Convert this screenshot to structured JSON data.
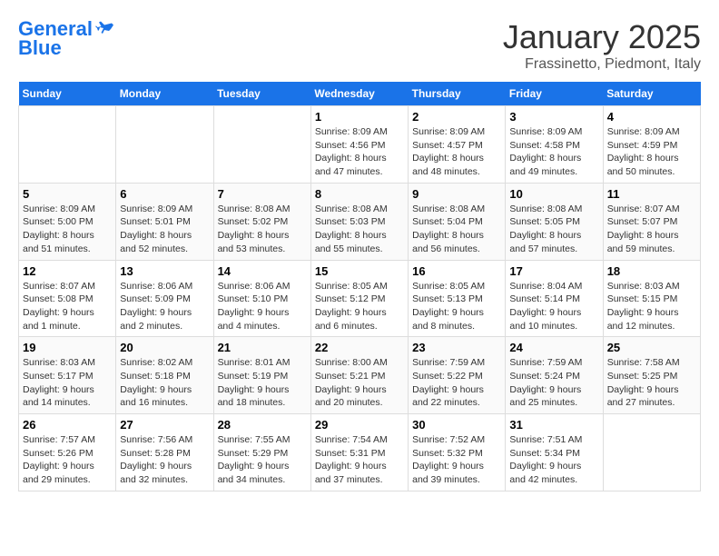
{
  "header": {
    "logo_line1": "General",
    "logo_line2": "Blue",
    "month": "January 2025",
    "location": "Frassinetto, Piedmont, Italy"
  },
  "weekdays": [
    "Sunday",
    "Monday",
    "Tuesday",
    "Wednesday",
    "Thursday",
    "Friday",
    "Saturday"
  ],
  "weeks": [
    [
      {
        "day": "",
        "info": ""
      },
      {
        "day": "",
        "info": ""
      },
      {
        "day": "",
        "info": ""
      },
      {
        "day": "1",
        "info": "Sunrise: 8:09 AM\nSunset: 4:56 PM\nDaylight: 8 hours\nand 47 minutes."
      },
      {
        "day": "2",
        "info": "Sunrise: 8:09 AM\nSunset: 4:57 PM\nDaylight: 8 hours\nand 48 minutes."
      },
      {
        "day": "3",
        "info": "Sunrise: 8:09 AM\nSunset: 4:58 PM\nDaylight: 8 hours\nand 49 minutes."
      },
      {
        "day": "4",
        "info": "Sunrise: 8:09 AM\nSunset: 4:59 PM\nDaylight: 8 hours\nand 50 minutes."
      }
    ],
    [
      {
        "day": "5",
        "info": "Sunrise: 8:09 AM\nSunset: 5:00 PM\nDaylight: 8 hours\nand 51 minutes."
      },
      {
        "day": "6",
        "info": "Sunrise: 8:09 AM\nSunset: 5:01 PM\nDaylight: 8 hours\nand 52 minutes."
      },
      {
        "day": "7",
        "info": "Sunrise: 8:08 AM\nSunset: 5:02 PM\nDaylight: 8 hours\nand 53 minutes."
      },
      {
        "day": "8",
        "info": "Sunrise: 8:08 AM\nSunset: 5:03 PM\nDaylight: 8 hours\nand 55 minutes."
      },
      {
        "day": "9",
        "info": "Sunrise: 8:08 AM\nSunset: 5:04 PM\nDaylight: 8 hours\nand 56 minutes."
      },
      {
        "day": "10",
        "info": "Sunrise: 8:08 AM\nSunset: 5:05 PM\nDaylight: 8 hours\nand 57 minutes."
      },
      {
        "day": "11",
        "info": "Sunrise: 8:07 AM\nSunset: 5:07 PM\nDaylight: 8 hours\nand 59 minutes."
      }
    ],
    [
      {
        "day": "12",
        "info": "Sunrise: 8:07 AM\nSunset: 5:08 PM\nDaylight: 9 hours\nand 1 minute."
      },
      {
        "day": "13",
        "info": "Sunrise: 8:06 AM\nSunset: 5:09 PM\nDaylight: 9 hours\nand 2 minutes."
      },
      {
        "day": "14",
        "info": "Sunrise: 8:06 AM\nSunset: 5:10 PM\nDaylight: 9 hours\nand 4 minutes."
      },
      {
        "day": "15",
        "info": "Sunrise: 8:05 AM\nSunset: 5:12 PM\nDaylight: 9 hours\nand 6 minutes."
      },
      {
        "day": "16",
        "info": "Sunrise: 8:05 AM\nSunset: 5:13 PM\nDaylight: 9 hours\nand 8 minutes."
      },
      {
        "day": "17",
        "info": "Sunrise: 8:04 AM\nSunset: 5:14 PM\nDaylight: 9 hours\nand 10 minutes."
      },
      {
        "day": "18",
        "info": "Sunrise: 8:03 AM\nSunset: 5:15 PM\nDaylight: 9 hours\nand 12 minutes."
      }
    ],
    [
      {
        "day": "19",
        "info": "Sunrise: 8:03 AM\nSunset: 5:17 PM\nDaylight: 9 hours\nand 14 minutes."
      },
      {
        "day": "20",
        "info": "Sunrise: 8:02 AM\nSunset: 5:18 PM\nDaylight: 9 hours\nand 16 minutes."
      },
      {
        "day": "21",
        "info": "Sunrise: 8:01 AM\nSunset: 5:19 PM\nDaylight: 9 hours\nand 18 minutes."
      },
      {
        "day": "22",
        "info": "Sunrise: 8:00 AM\nSunset: 5:21 PM\nDaylight: 9 hours\nand 20 minutes."
      },
      {
        "day": "23",
        "info": "Sunrise: 7:59 AM\nSunset: 5:22 PM\nDaylight: 9 hours\nand 22 minutes."
      },
      {
        "day": "24",
        "info": "Sunrise: 7:59 AM\nSunset: 5:24 PM\nDaylight: 9 hours\nand 25 minutes."
      },
      {
        "day": "25",
        "info": "Sunrise: 7:58 AM\nSunset: 5:25 PM\nDaylight: 9 hours\nand 27 minutes."
      }
    ],
    [
      {
        "day": "26",
        "info": "Sunrise: 7:57 AM\nSunset: 5:26 PM\nDaylight: 9 hours\nand 29 minutes."
      },
      {
        "day": "27",
        "info": "Sunrise: 7:56 AM\nSunset: 5:28 PM\nDaylight: 9 hours\nand 32 minutes."
      },
      {
        "day": "28",
        "info": "Sunrise: 7:55 AM\nSunset: 5:29 PM\nDaylight: 9 hours\nand 34 minutes."
      },
      {
        "day": "29",
        "info": "Sunrise: 7:54 AM\nSunset: 5:31 PM\nDaylight: 9 hours\nand 37 minutes."
      },
      {
        "day": "30",
        "info": "Sunrise: 7:52 AM\nSunset: 5:32 PM\nDaylight: 9 hours\nand 39 minutes."
      },
      {
        "day": "31",
        "info": "Sunrise: 7:51 AM\nSunset: 5:34 PM\nDaylight: 9 hours\nand 42 minutes."
      },
      {
        "day": "",
        "info": ""
      }
    ]
  ]
}
